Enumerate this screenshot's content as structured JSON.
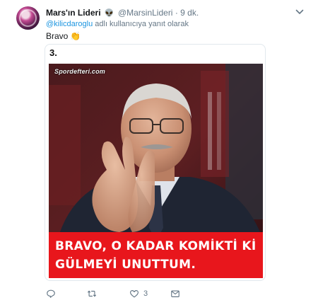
{
  "tweet": {
    "author_name": "Mars'ın Lideri",
    "author_emoji": "👽",
    "author_handle": "@MarsinLideri",
    "separator": "·",
    "time": "9 dk.",
    "reply_mention": "@kilicdaroglu",
    "reply_suffix": " adlı kullanıcıya yanıt olarak",
    "text": "Bravo",
    "text_emoji": "👏"
  },
  "card": {
    "number_label": "3.",
    "watermark": "Spordefteri.com",
    "caption": "BRAVO, O KADAR KOMİKTİ Kİ\nGÜLMEYİ UNUTTUM."
  },
  "actions": {
    "reply_count": "",
    "retweet_count": "",
    "like_count": "3"
  },
  "colors": {
    "link": "#1b95e0",
    "muted": "#657786",
    "caption_band": "#e8161c"
  },
  "icons": [
    "avatar",
    "alien-emoji",
    "chevron-down-icon",
    "clapping-hands-icon",
    "reply-icon",
    "retweet-icon",
    "like-icon",
    "dm-icon"
  ]
}
